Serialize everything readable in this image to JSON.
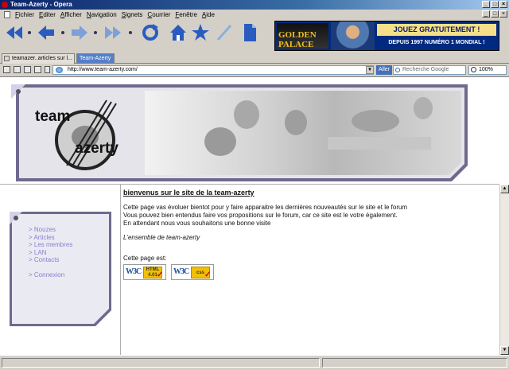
{
  "window": {
    "title": "Team-Azerty - Opera"
  },
  "menu": {
    "items": [
      {
        "key": "F",
        "rest": "ichier"
      },
      {
        "key": "E",
        "rest": "diter"
      },
      {
        "key": "A",
        "rest": "fficher"
      },
      {
        "key": "N",
        "rest": "avigation"
      },
      {
        "key": "S",
        "rest": "ignets"
      },
      {
        "key": "C",
        "rest": "ourrier"
      },
      {
        "key": "F",
        "rest": "enêtre"
      },
      {
        "key": "A",
        "rest": "ide"
      }
    ]
  },
  "ad": {
    "logo": "GOLDEN PALACE",
    "line1": "JOUEZ GRATUITEMENT !",
    "line2": "DEPUIS 1997 NUMÉRO 1 MONDIAL !"
  },
  "tabs": [
    {
      "label": "teamazer..articles sur l..."
    },
    {
      "label": "Team-Azerty"
    }
  ],
  "address": {
    "url": "http://www.team-azerty.com/",
    "go_label": "Aller",
    "search_placeholder": "Recherche Google",
    "zoom": "100%"
  },
  "site": {
    "logo_line1": "team",
    "logo_line2": "azerty",
    "nav": [
      "> Nouzes",
      "> Articles",
      "> Les membres",
      "> LAN",
      "> Contacts"
    ],
    "nav_login": "> Connexion",
    "welcome": "bienvenus sur le site de la team-azerty",
    "para1": "Cette page vas évoluer bientot pour y faire apparaitre les dernières nouveautés sur le site et le forum",
    "para2": "Vous pouvez bien entendus faire vos propositions sur le forum, car ce site est le votre également.",
    "para3": "En attendant nous vous souhaitons une bonne visite",
    "signature": "L'ensemble de team-azerty",
    "validity": "Cette page est:",
    "badge_html": {
      "w3c": "W3C",
      "label1": "HTML",
      "label2": "4.01"
    },
    "badge_css": {
      "w3c": "W3C",
      "label1": "css"
    }
  },
  "colors": {
    "nav_link": "#8a7fcf",
    "panel_border": "#6e6a8e",
    "panel_fill": "#e8e8f0",
    "tab_active": "#5580c8"
  }
}
